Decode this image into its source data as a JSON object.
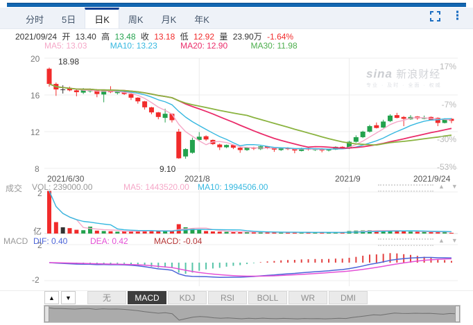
{
  "toolbar": {
    "tabs": [
      "分时",
      "5日",
      "日K",
      "周K",
      "月K",
      "年K"
    ],
    "active_tab": "日K",
    "fullscreen_icon": "fullscreen-icon",
    "menu_icon": "kebab-menu-icon"
  },
  "info_bar": {
    "date": "2021/09/24",
    "open_label": "开",
    "open": "13.40",
    "high_label": "高",
    "high": "13.48",
    "close_label": "收",
    "close": "13.18",
    "low_label": "低",
    "low": "12.92",
    "volume_label": "量",
    "volume": "23.90万",
    "change": "-1.64%"
  },
  "ma_bar": {
    "ma5": "MA5: 13.03",
    "ma10": "MA10: 13.23",
    "ma20": "MA20: 12.90",
    "ma30": "MA30: 11.98"
  },
  "watermark": {
    "brand": "sina",
    "name": "新浪财经",
    "slogan": "专业 · 及时 · 全面 · 权威"
  },
  "volume_pane": {
    "label": "成交",
    "vol": "VOL: 239000.00",
    "ma5": "MA5: 1443520.00",
    "ma10": "MA10: 1994506.00",
    "axis_top": "2",
    "axis_unit": "亿"
  },
  "macd_pane": {
    "label": "MACD",
    "dif": "DIF: 0.40",
    "dea": "DEA: 0.42",
    "macd": "MACD: -0.04",
    "axis_top": "2",
    "axis_bottom": "-2"
  },
  "indicator_tabs": {
    "items": [
      "无",
      "MACD",
      "KDJ",
      "RSI",
      "BOLL",
      "WR",
      "DMI"
    ],
    "active": "MACD",
    "up_arrow": "▲",
    "down_arrow": "▼"
  },
  "chart_data": {
    "type": "candlestick",
    "title": "日K 2021/6/30 - 2021/9/24",
    "main": {
      "left_axis": [
        "20",
        "16",
        "12",
        "8"
      ],
      "right_axis": [
        "17%",
        "-7%",
        "-30%",
        "-53%"
      ],
      "x_axis": [
        "2021/6/30",
        "2021/8",
        "2021/9",
        "2021/9/24"
      ],
      "price_range": [
        8,
        20
      ],
      "annotations": {
        "high": "18.98",
        "low": "9.10"
      },
      "vgrid_day_index": [
        22,
        44
      ]
    },
    "ohlcv_note": "per day: [open, high, low, close, volume_in_yi]",
    "candles": [
      [
        18.85,
        18.98,
        16.9,
        17.2,
        2.05
      ],
      [
        17.2,
        17.35,
        15.9,
        16.6,
        0.55
      ],
      [
        16.6,
        17.05,
        16.15,
        16.6,
        0.3
      ],
      [
        16.75,
        16.9,
        16.4,
        16.5,
        0.26
      ],
      [
        16.5,
        16.6,
        15.85,
        16.3,
        0.18
      ],
      [
        16.25,
        16.75,
        16.1,
        16.55,
        0.16
      ],
      [
        16.4,
        16.7,
        16.25,
        16.6,
        0.33
      ],
      [
        16.55,
        16.6,
        15.75,
        16.1,
        0.14
      ],
      [
        16.05,
        16.55,
        15.2,
        16.5,
        0.12
      ],
      [
        16.5,
        16.95,
        16.2,
        16.3,
        0.11
      ],
      [
        16.2,
        16.45,
        16.05,
        16.35,
        0.09
      ],
      [
        16.35,
        16.45,
        16.0,
        16.1,
        0.1
      ],
      [
        16.1,
        16.15,
        15.45,
        15.7,
        0.12
      ],
      [
        15.7,
        15.75,
        15.05,
        15.3,
        0.13
      ],
      [
        15.3,
        15.35,
        14.4,
        14.65,
        0.15
      ],
      [
        14.65,
        14.7,
        13.9,
        14.1,
        0.14
      ],
      [
        14.1,
        14.15,
        13.35,
        13.6,
        0.13
      ],
      [
        13.5,
        14.5,
        13.0,
        13.95,
        0.12
      ],
      [
        13.95,
        14.0,
        13.0,
        13.25,
        0.11
      ],
      [
        12.0,
        12.3,
        9.05,
        9.1,
        0.45
      ],
      [
        9.3,
        10.2,
        9.05,
        10.1,
        0.3
      ],
      [
        9.7,
        11.35,
        9.6,
        11.1,
        0.25
      ],
      [
        11.1,
        11.95,
        10.95,
        11.45,
        0.18
      ],
      [
        11.5,
        11.6,
        11.0,
        11.15,
        0.12
      ],
      [
        11.1,
        11.15,
        10.55,
        10.65,
        0.1
      ],
      [
        10.6,
        10.7,
        10.0,
        10.3,
        0.09
      ],
      [
        10.3,
        10.6,
        10.2,
        10.55,
        0.08
      ],
      [
        10.55,
        10.6,
        10.1,
        10.25,
        0.07
      ],
      [
        10.25,
        10.3,
        9.7,
        10.0,
        0.08
      ],
      [
        10.0,
        10.35,
        9.9,
        10.3,
        0.07
      ],
      [
        10.3,
        10.35,
        10.0,
        10.15,
        0.06
      ],
      [
        10.1,
        10.45,
        10.0,
        10.4,
        0.07
      ],
      [
        10.4,
        10.45,
        10.1,
        10.2,
        0.06
      ],
      [
        10.2,
        10.25,
        9.8,
        10.05,
        0.06
      ],
      [
        10.0,
        10.3,
        9.9,
        10.25,
        0.05
      ],
      [
        10.25,
        10.3,
        10.0,
        10.1,
        0.05
      ],
      [
        10.1,
        10.15,
        9.65,
        9.95,
        0.06
      ],
      [
        9.9,
        10.25,
        9.85,
        10.2,
        0.05
      ],
      [
        10.2,
        10.25,
        9.95,
        10.05,
        0.05
      ],
      [
        10.0,
        10.2,
        9.9,
        10.15,
        0.05
      ],
      [
        10.15,
        10.2,
        9.75,
        9.95,
        0.06
      ],
      [
        9.95,
        10.15,
        9.85,
        10.1,
        0.05
      ],
      [
        10.05,
        10.4,
        10.0,
        10.35,
        0.06
      ],
      [
        10.35,
        10.4,
        10.1,
        10.2,
        0.05
      ],
      [
        10.3,
        11.0,
        10.1,
        10.9,
        0.12
      ],
      [
        10.9,
        11.6,
        10.8,
        11.4,
        0.14
      ],
      [
        11.4,
        12.1,
        11.3,
        12.0,
        0.15
      ],
      [
        12.0,
        12.75,
        11.9,
        12.6,
        0.16
      ],
      [
        12.7,
        13.0,
        12.35,
        12.4,
        0.12
      ],
      [
        12.45,
        13.3,
        12.4,
        13.1,
        0.14
      ],
      [
        13.15,
        13.9,
        13.05,
        13.75,
        0.15
      ],
      [
        13.8,
        14.05,
        13.45,
        13.5,
        0.12
      ],
      [
        13.6,
        13.7,
        12.6,
        13.4,
        0.1
      ],
      [
        13.35,
        13.8,
        13.3,
        13.6,
        0.09
      ],
      [
        13.65,
        13.7,
        13.3,
        13.45,
        0.08
      ],
      [
        13.4,
        13.75,
        13.35,
        13.55,
        0.08
      ],
      [
        13.6,
        13.65,
        13.25,
        13.3,
        0.07
      ],
      [
        13.5,
        13.55,
        12.6,
        12.95,
        0.09
      ],
      [
        12.95,
        13.45,
        12.9,
        13.4,
        0.08
      ],
      [
        13.4,
        13.48,
        12.92,
        13.18,
        0.024
      ]
    ],
    "volume_axis": {
      "max_yi": 2
    },
    "macd_axis": {
      "range": [
        -2,
        2
      ]
    },
    "colors": {
      "up": "#23a24d",
      "down": "#f12b2b",
      "doji": "#333333",
      "ma5": "#f5a8c8",
      "ma10": "#36b8e0",
      "ma20": "#ea2c6a",
      "ma30": "#8ab33f",
      "dif": "#4a63d8",
      "dea": "#e44fd6",
      "hist_pos": "#e34040",
      "hist_neg": "#56c4a7",
      "accent": "#1b6ec2",
      "grid": "#ececec"
    }
  }
}
